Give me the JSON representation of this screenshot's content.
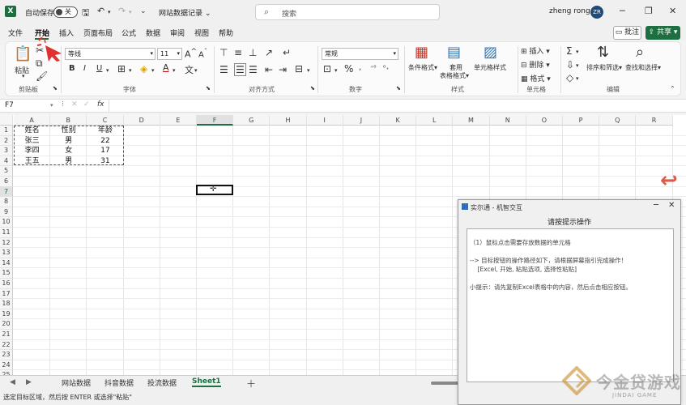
{
  "titlebar": {
    "app_icon": "X",
    "autosave_label": "自动保存",
    "autosave_state": "关",
    "doc_title": "网站数据记录",
    "search_placeholder": "搜索",
    "username": "zheng rong",
    "avatar_initials": "ZR"
  },
  "menu": {
    "tabs": [
      "文件",
      "开始",
      "插入",
      "页面布局",
      "公式",
      "数据",
      "审阅",
      "视图",
      "帮助"
    ],
    "active_tab": "开始",
    "comment_label": "批注",
    "share_label": "共享"
  },
  "ribbon": {
    "paste_label": "粘贴",
    "clipboard_group": "剪贴板",
    "font_name": "等线",
    "font_size": "11",
    "font_group": "字体",
    "align_group": "对齐方式",
    "number_format": "常规",
    "number_group": "数字",
    "cond_format_label": "条件格式",
    "table_format_label_1": "套用",
    "table_format_label_2": "表格格式",
    "cell_style_label": "单元格样式",
    "styles_group": "样式",
    "insert_label": "插入",
    "delete_label": "删除",
    "format_label": "格式",
    "cells_group": "单元格",
    "sort_filter_label": "排序和筛选",
    "find_select_label": "查找和选择",
    "editing_group": "编辑"
  },
  "formula_bar": {
    "name_box": "F7",
    "fx_label": "fx"
  },
  "grid": {
    "columns": [
      "A",
      "B",
      "C",
      "D",
      "E",
      "F",
      "G",
      "H",
      "I",
      "J",
      "K",
      "L",
      "M",
      "N",
      "O",
      "P",
      "Q",
      "R"
    ],
    "selected_column": "F",
    "rows": [
      "1",
      "2",
      "3",
      "4",
      "5",
      "6",
      "7",
      "8",
      "9",
      "10",
      "11",
      "12",
      "13",
      "14",
      "15",
      "16",
      "17",
      "18",
      "19",
      "20",
      "21",
      "22",
      "23",
      "24",
      "25"
    ],
    "selected_row": "7",
    "data": [
      [
        "姓名",
        "性别",
        "年龄"
      ],
      [
        "张三",
        "男",
        "22"
      ],
      [
        "李四",
        "女",
        "17"
      ],
      [
        "王五",
        "男",
        "31"
      ]
    ]
  },
  "sheets": {
    "tabs": [
      "网站数据",
      "抖音数据",
      "投流数据",
      "Sheet1"
    ],
    "active": "Sheet1"
  },
  "status_text": "选定目标区域，然后按 ENTER 或选择\"粘贴\"",
  "dialog": {
    "title": "实尔通 - 机智交互",
    "heading": "请按提示操作",
    "lines": [
      "（1）鼠标点击需要存放数据的单元格",
      "--> 目标按钮的操作路径如下，请根据屏幕指引完成操作！",
      "    [Excel, 开始, 粘贴选项, 选择性粘贴]",
      "小提示：请先复制Excel表格中的内容，然后点击相应按钮。"
    ]
  },
  "watermark": {
    "main": "今金贷游戏",
    "sub": "JINDAI GAME"
  },
  "colors": {
    "excel_green": "#1d6f42",
    "pointer_red": "#e03030"
  }
}
